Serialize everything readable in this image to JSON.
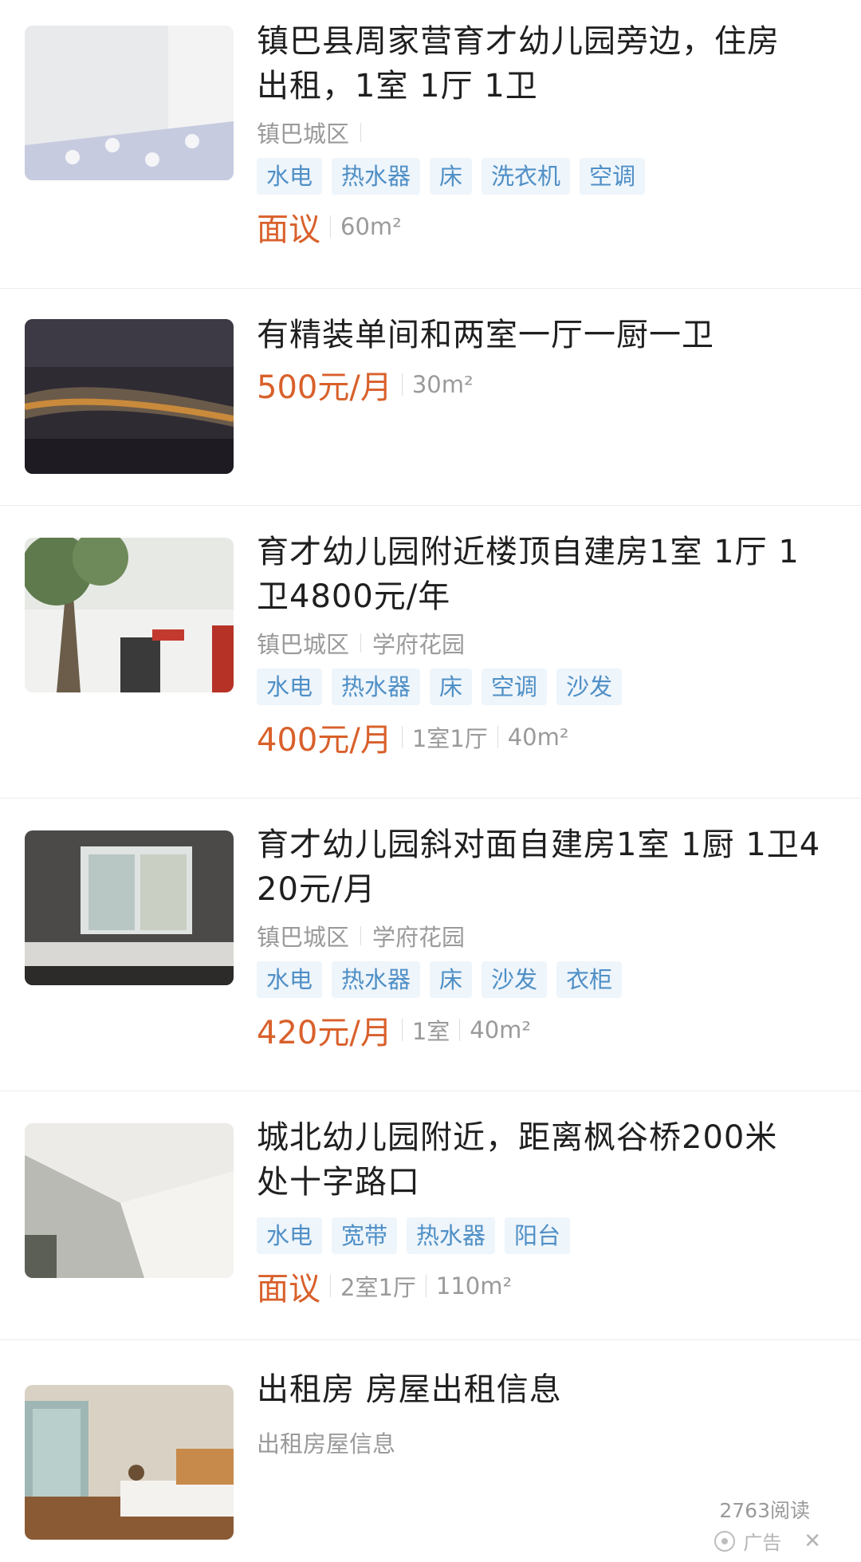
{
  "listings": [
    {
      "title_line1": "镇巴县周家营育才幼儿园旁边，住房",
      "title_line2": "出租，1室 1厅 1卫",
      "location": "镇巴城区",
      "community": "",
      "tags": [
        "水电",
        "热水器",
        "床",
        "洗衣机",
        "空调"
      ],
      "price": "面议",
      "specs": [
        "60m²"
      ]
    },
    {
      "title_line1": "有精装单间和两室一厅一厨一卫",
      "title_line2": "",
      "price": "500元/月",
      "specs": [
        "30m²"
      ]
    },
    {
      "title_line1": "育才幼儿园附近楼顶自建房1室 1厅 1",
      "title_line2": "卫4800元/年",
      "location": "镇巴城区",
      "community": "学府花园",
      "tags": [
        "水电",
        "热水器",
        "床",
        "空调",
        "沙发"
      ],
      "price": "400元/月",
      "specs": [
        "1室1厅",
        "40m²"
      ]
    },
    {
      "title_line1": "育才幼儿园斜对面自建房1室 1厨 1卫4",
      "title_line2": "20元/月",
      "location": "镇巴城区",
      "community": "学府花园",
      "tags": [
        "水电",
        "热水器",
        "床",
        "沙发",
        "衣柜"
      ],
      "price": "420元/月",
      "specs": [
        "1室",
        "40m²"
      ]
    },
    {
      "title_line1": "城北幼儿园附近，距离枫谷桥200米",
      "title_line2": "处十字路口",
      "tags": [
        "水电",
        "宽带",
        "热水器",
        "阳台"
      ],
      "price": "面议",
      "specs": [
        "2室1厅",
        "110m²"
      ]
    },
    {
      "title_line1": "出租房 房屋出租信息",
      "subtitle": "出租房屋信息"
    }
  ],
  "footer": {
    "read_count": "2763阅读",
    "ad_label": "广告",
    "close_symbol": "✕"
  },
  "colors": {
    "price": "#d9602b",
    "tag_bg": "#eef5fb",
    "tag_text": "#4f8fc6"
  }
}
